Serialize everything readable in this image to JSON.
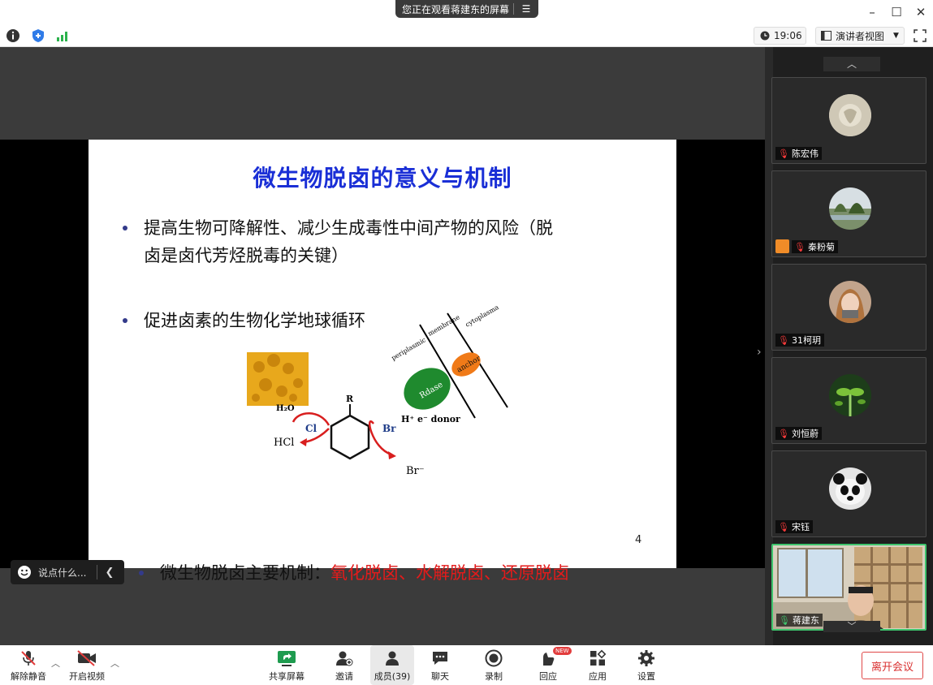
{
  "banner": {
    "text": "您正在观看蒋建东的屏幕"
  },
  "toolbar": {
    "time": "19:06",
    "view_label": "演讲者视图"
  },
  "slide": {
    "title": "微生物脱卤的意义与机制",
    "bullet1_line1": "提高生物可降解性、减少生成毒性中间产物的风险（脱",
    "bullet1_line2": "卤是卤代芳烃脱毒的关键）",
    "bullet2": "促进卤素的生物化学地球循环",
    "bullet3_prefix": "微生物脱卤主要机制：",
    "bullet3_highlight": "氧化脱卤、水解脱卤、还原脱卤",
    "page_number": "4",
    "figure": {
      "zone_periplasmic": "periplasmic",
      "zone_membrane": "membrane",
      "zone_cytoplasma": "cytoplasma",
      "enzyme": "Rdase",
      "anchor": "anchor",
      "donor": "H⁺ e⁻ donor",
      "water": "H₂O",
      "substituent": "R",
      "cl": "Cl",
      "br": "Br",
      "hcl": "HCl",
      "br_ion": "Br⁻"
    }
  },
  "chat": {
    "placeholder": "说点什么..."
  },
  "participants": [
    {
      "name": "陈宏伟"
    },
    {
      "name": "秦粉菊"
    },
    {
      "name": "31柯玥"
    },
    {
      "name": "刘恒蔚"
    },
    {
      "name": "宋钰"
    },
    {
      "name": "蒋建东"
    }
  ],
  "bottombar": {
    "unmute": "解除静音",
    "start_video": "开启视频",
    "share": "共享屏幕",
    "invite": "邀请",
    "members": "成员(39)",
    "chat": "聊天",
    "record": "录制",
    "react": "回应",
    "react_badge": "NEW",
    "apps": "应用",
    "settings": "设置",
    "leave": "离开会议"
  },
  "colors": {
    "title_blue": "#1a2fd6",
    "highlight_red": "#e31b1b",
    "leave_red": "#d93030",
    "active_speaker": "#3ec46d"
  }
}
